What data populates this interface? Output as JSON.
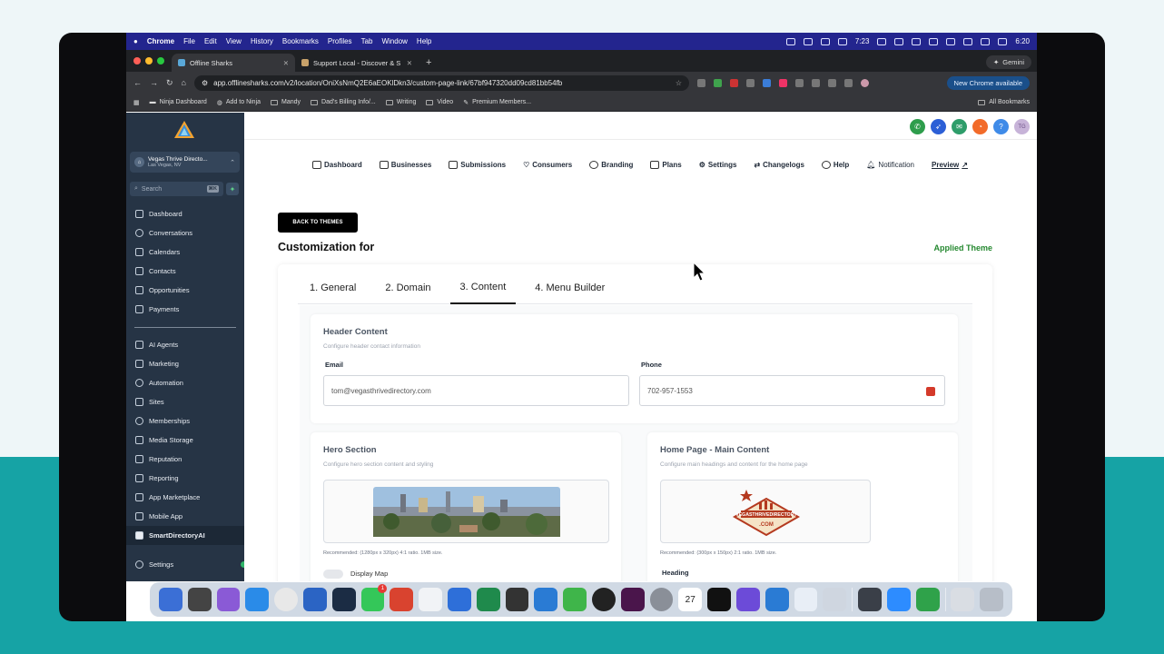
{
  "menubar": {
    "app": "Chrome",
    "items": [
      "File",
      "Edit",
      "View",
      "History",
      "Bookmarks",
      "Profiles",
      "Tab",
      "Window",
      "Help"
    ],
    "time": "7:23",
    "clock": "6:20"
  },
  "tabs": [
    {
      "title": "Offline Sharks"
    },
    {
      "title": "Support Local - Discover & S"
    }
  ],
  "gemini": "Gemini",
  "address": "app.offlinesharks.com/v2/location/OniXsNmQ2E6aEOKlDkn3/custom-page-link/67bf947320dd09cd81bb54fb",
  "new_chrome": "New Chrome available",
  "bookmarks": [
    "Ninja Dashboard",
    "Add to Ninja",
    "Mandy",
    "Dad's Billing Info/...",
    "Writing",
    "Video",
    "Premium Members..."
  ],
  "all_bookmarks": "All Bookmarks",
  "sidebar": {
    "location_name": "Vegas Thrive Directo...",
    "location_city": "Las Vegas, NV",
    "search_placeholder": "Search",
    "search_kbd": "⌘K",
    "items_top": [
      "Dashboard",
      "Conversations",
      "Calendars",
      "Contacts",
      "Opportunities",
      "Payments"
    ],
    "items_bottom": [
      "AI Agents",
      "Marketing",
      "Automation",
      "Sites",
      "Memberships",
      "Media Storage",
      "Reputation",
      "Reporting",
      "App Marketplace",
      "Mobile App",
      "SmartDirectoryAI"
    ],
    "settings": "Settings"
  },
  "topbar": {
    "avatar": "TG"
  },
  "menu": [
    "Dashboard",
    "Businesses",
    "Submissions",
    "Consumers",
    "Branding",
    "Plans",
    "Settings",
    "Changelogs",
    "Help",
    "Notification",
    "Preview"
  ],
  "page": {
    "back": "BACK TO THEMES",
    "title": "Customization for",
    "applied": "Applied Theme"
  },
  "content_tabs": [
    "1. General",
    "2. Domain",
    "3. Content",
    "4. Menu Builder"
  ],
  "header_content": {
    "title": "Header Content",
    "subtitle": "Configure header contact information",
    "email_label": "Email",
    "email_value": "tom@vegasthrivedirectory.com",
    "phone_label": "Phone",
    "phone_value": "702-957-1553"
  },
  "hero": {
    "title": "Hero Section",
    "subtitle": "Configure hero section content and styling",
    "rec": "Recommended: (1280px x 320px) 4:1 ratio. 1MB size.",
    "toggle_label": "Display Map"
  },
  "home": {
    "title": "Home Page - Main Content",
    "subtitle": "Configure main headings and content for the home page",
    "rec": "Recommended: (300px x 150px) 2:1 ratio. 1MB size.",
    "logo_line1": "VEGASTHRIVEDIRECTORY",
    ".com": ".COM",
    "heading_label": "Heading"
  },
  "dock_badges": {
    "messages": "1",
    "calendar": "27"
  }
}
